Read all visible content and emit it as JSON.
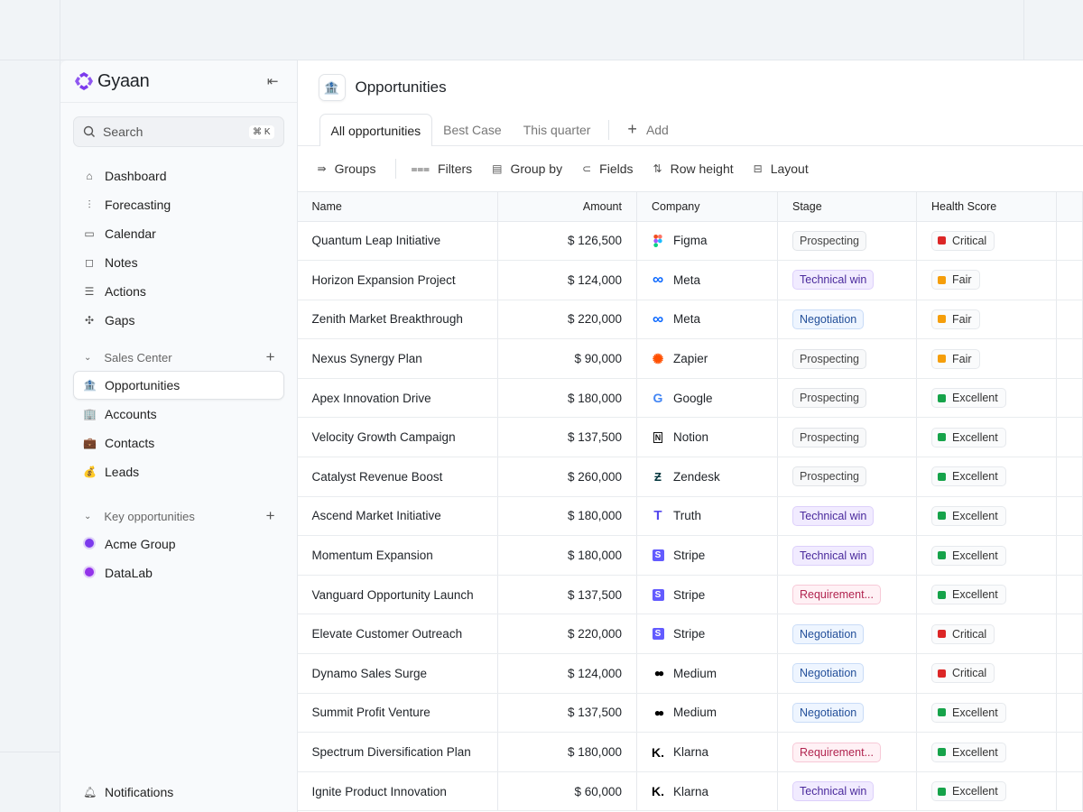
{
  "brand": {
    "name": "Gyaan",
    "accent": "#7c3aed"
  },
  "search": {
    "label": "Search",
    "shortcut": "⌘ K"
  },
  "nav": [
    {
      "label": "Dashboard",
      "icon": "home-icon"
    },
    {
      "label": "Forecasting",
      "icon": "chart-icon"
    },
    {
      "label": "Calendar",
      "icon": "calendar-icon"
    },
    {
      "label": "Notes",
      "icon": "note-icon"
    },
    {
      "label": "Actions",
      "icon": "list-icon"
    },
    {
      "label": "Gaps",
      "icon": "puzzle-icon"
    }
  ],
  "sales_center": {
    "title": "Sales Center",
    "items": [
      {
        "label": "Opportunities",
        "icon": "🏦",
        "active": true
      },
      {
        "label": "Accounts",
        "icon": "🏢"
      },
      {
        "label": "Contacts",
        "icon": "💼"
      },
      {
        "label": "Leads",
        "icon": "💰"
      }
    ]
  },
  "key_opps": {
    "title": "Key opportunities",
    "items": [
      {
        "label": "Acme Group",
        "color": "#7c3aed"
      },
      {
        "label": "DataLab",
        "color": "#9333ea"
      }
    ]
  },
  "notifications": "Notifications",
  "page": {
    "title": "Opportunities",
    "icon": "🏦"
  },
  "tabs": [
    "All opportunities",
    "Best Case",
    "This quarter"
  ],
  "add_tab": "Add",
  "toolbar": [
    "Groups",
    "Filters",
    "Group by",
    "Fields",
    "Row height",
    "Layout"
  ],
  "columns": [
    "Name",
    "Amount",
    "Company",
    "Stage",
    "Health Score"
  ],
  "rows": [
    [
      "Quantum Leap Initiative",
      "$ 126,500",
      "Figma",
      "Prospecting",
      "Critical"
    ],
    [
      "Horizon Expansion Project",
      "$ 124,000",
      "Meta",
      "Technical win",
      "Fair"
    ],
    [
      "Zenith Market Breakthrough",
      "$ 220,000",
      "Meta",
      "Negotiation",
      "Fair"
    ],
    [
      "Nexus Synergy Plan",
      "$ 90,000",
      "Zapier",
      "Prospecting",
      "Fair"
    ],
    [
      "Apex Innovation Drive",
      "$ 180,000",
      "Google",
      "Prospecting",
      "Excellent"
    ],
    [
      "Velocity Growth Campaign",
      "$ 137,500",
      "Notion",
      "Prospecting",
      "Excellent"
    ],
    [
      "Catalyst Revenue Boost",
      "$ 260,000",
      "Zendesk",
      "Prospecting",
      "Excellent"
    ],
    [
      "Ascend Market Initiative",
      "$ 180,000",
      "Truth",
      "Technical win",
      "Excellent"
    ],
    [
      "Momentum Expansion",
      "$ 180,000",
      "Stripe",
      "Technical win",
      "Excellent"
    ],
    [
      "Vanguard Opportunity Launch",
      "$ 137,500",
      "Stripe",
      "Requirement...",
      "Excellent"
    ],
    [
      "Elevate Customer Outreach",
      "$ 220,000",
      "Stripe",
      "Negotiation",
      "Critical"
    ],
    [
      "Dynamo Sales Surge",
      "$ 124,000",
      "Medium",
      "Negotiation",
      "Critical"
    ],
    [
      "Summit Profit Venture",
      "$ 137,500",
      "Medium",
      "Negotiation",
      "Excellent"
    ],
    [
      "Spectrum Diversification Plan",
      "$ 180,000",
      "Klarna",
      "Requirement...",
      "Excellent"
    ],
    [
      "Ignite Product Innovation",
      "$ 60,000",
      "Klarna",
      "Technical win",
      "Excellent"
    ]
  ],
  "health_colors": {
    "Critical": "#dc2626",
    "Fair": "#f59e0b",
    "Excellent": "#16a34a"
  }
}
